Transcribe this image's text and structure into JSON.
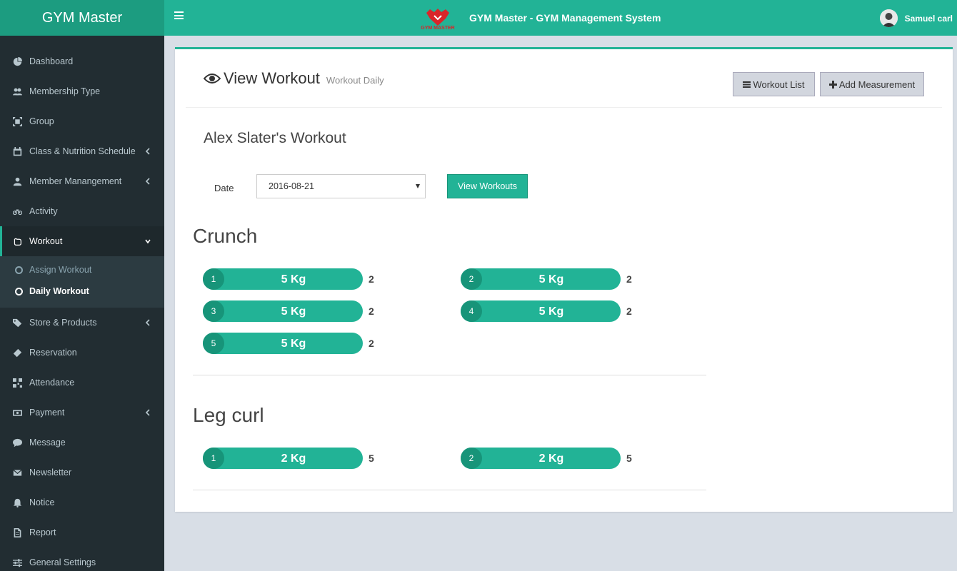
{
  "brand": {
    "name": "GYM Master"
  },
  "header": {
    "logo_text": "GYM MASTER",
    "title": "GYM Master - GYM Management System",
    "user_name": "Samuel carl"
  },
  "sidebar": {
    "items": [
      {
        "label": "Dashboard",
        "icon": "dashboard-icon"
      },
      {
        "label": "Membership Type",
        "icon": "users-icon"
      },
      {
        "label": "Group",
        "icon": "group-icon"
      },
      {
        "label": "Class & Nutrition Schedule",
        "icon": "calendar-icon",
        "has_submenu": true
      },
      {
        "label": "Member Manangement",
        "icon": "user-icon",
        "has_submenu": true
      },
      {
        "label": "Activity",
        "icon": "bicycle-icon"
      },
      {
        "label": "Workout",
        "icon": "hand-icon",
        "active": true,
        "expanded": true
      },
      {
        "label": "Store & Products",
        "icon": "tags-icon",
        "has_submenu": true
      },
      {
        "label": "Reservation",
        "icon": "ticket-icon"
      },
      {
        "label": "Attendance",
        "icon": "qrcode-icon"
      },
      {
        "label": "Payment",
        "icon": "money-icon",
        "has_submenu": true
      },
      {
        "label": "Message",
        "icon": "comment-icon"
      },
      {
        "label": "Newsletter",
        "icon": "envelope-icon"
      },
      {
        "label": "Notice",
        "icon": "bell-icon"
      },
      {
        "label": "Report",
        "icon": "file-icon"
      },
      {
        "label": "General Settings",
        "icon": "sliders-icon"
      }
    ],
    "workout_submenu": [
      {
        "label": "Assign Workout"
      },
      {
        "label": "Daily Workout",
        "current": true
      }
    ]
  },
  "page": {
    "title": "View Workout",
    "subtitle": "Workout Daily",
    "workout_list_label": "Workout List",
    "add_measurement_label": "Add Measurement",
    "member_title": "Alex Slater's Workout",
    "date_label": "Date",
    "date_value": "2016-08-21",
    "view_button_label": "View Workouts"
  },
  "exercises": [
    {
      "name": "Crunch",
      "sets": [
        {
          "num": "1",
          "weight": "5 Kg",
          "reps": "2"
        },
        {
          "num": "2",
          "weight": "5 Kg",
          "reps": "2"
        },
        {
          "num": "3",
          "weight": "5 Kg",
          "reps": "2"
        },
        {
          "num": "4",
          "weight": "5 Kg",
          "reps": "2"
        },
        {
          "num": "5",
          "weight": "5 Kg",
          "reps": "2"
        }
      ]
    },
    {
      "name": "Leg curl",
      "sets": [
        {
          "num": "1",
          "weight": "2 Kg",
          "reps": "5"
        },
        {
          "num": "2",
          "weight": "2 Kg",
          "reps": "5"
        }
      ]
    }
  ],
  "colors": {
    "teal": "#22b396",
    "teal_dark": "#1c9c80",
    "sidebar_bg": "#222d32",
    "logo_red": "#d9252a"
  }
}
